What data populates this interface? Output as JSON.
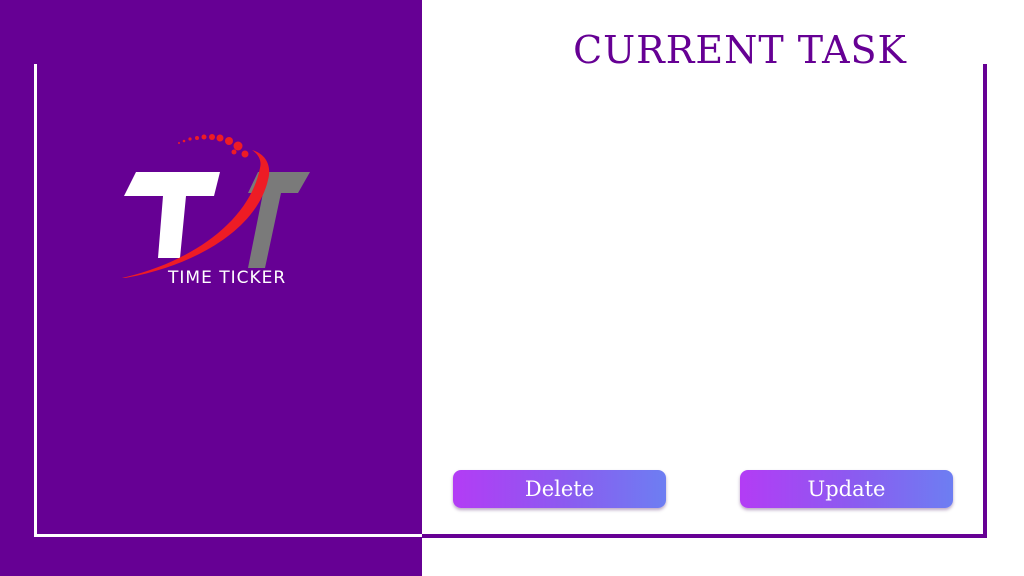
{
  "brand": {
    "logo_text": "TIME TICKER",
    "icon": "time-ticker-logo",
    "colors": {
      "panel": "#660094",
      "accent_red": "#ee1c25",
      "gray": "#7a7a7a"
    }
  },
  "main": {
    "title": "CURRENT TASK",
    "task_text": ""
  },
  "actions": {
    "delete_label": "Delete",
    "update_label": "Update"
  },
  "theme": {
    "button_gradient": [
      "#b33cf5",
      "#6d7ef2"
    ]
  }
}
